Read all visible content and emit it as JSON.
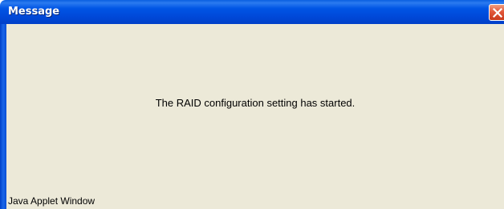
{
  "window": {
    "title": "Message",
    "close_icon": "close-icon",
    "colors": {
      "titlebar": "#0055e5",
      "client_background": "#ece9d8",
      "close_button": "#e2583a"
    }
  },
  "dialog": {
    "message": "The RAID configuration setting has started."
  },
  "status": {
    "label": "Java Applet Window"
  }
}
